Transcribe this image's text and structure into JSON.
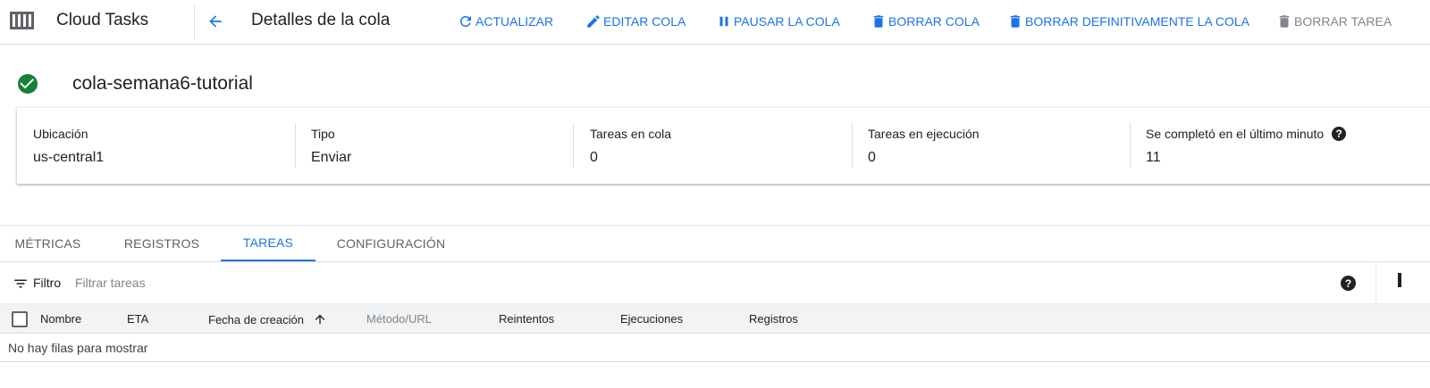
{
  "header": {
    "product_name": "Cloud Tasks",
    "page_title": "Detalles de la cola",
    "actions": {
      "refresh": "ACTUALIZAR",
      "edit": "EDITAR COLA",
      "pause": "PAUSAR LA COLA",
      "delete": "BORRAR COLA",
      "purge": "BORRAR DEFINITIVAMENTE LA COLA",
      "delete_task": "BORRAR TAREA"
    }
  },
  "queue": {
    "name": "cola-semana6-tutorial",
    "status_icon": "check-circle-icon",
    "status_color": "#188038",
    "info": [
      {
        "label": "Ubicación",
        "value": "us-central1"
      },
      {
        "label": "Tipo",
        "value": "Enviar"
      },
      {
        "label": "Tareas en cola",
        "value": "0"
      },
      {
        "label": "Tareas en ejecución",
        "value": "0"
      },
      {
        "label": "Se completó en el último minuto",
        "value": "11"
      }
    ]
  },
  "tabs": {
    "metrics": "MÉTRICAS",
    "logs": "REGISTROS",
    "tasks": "TAREAS",
    "config": "CONFIGURACIÓN",
    "active": "TAREAS"
  },
  "filter": {
    "label": "Filtro",
    "placeholder": "Filtrar tareas"
  },
  "table": {
    "columns": {
      "name": "Nombre",
      "eta": "ETA",
      "created": "Fecha de creación",
      "method": "Método/URL",
      "retries": "Reintentos",
      "executions": "Ejecuciones",
      "logs": "Registros"
    },
    "sort_column": "Fecha de creación",
    "sort_direction": "ascending",
    "empty_message": "No hay filas para mostrar"
  },
  "colors": {
    "accent": "#1a73e8",
    "disabled": "#80868b",
    "success": "#188038"
  }
}
